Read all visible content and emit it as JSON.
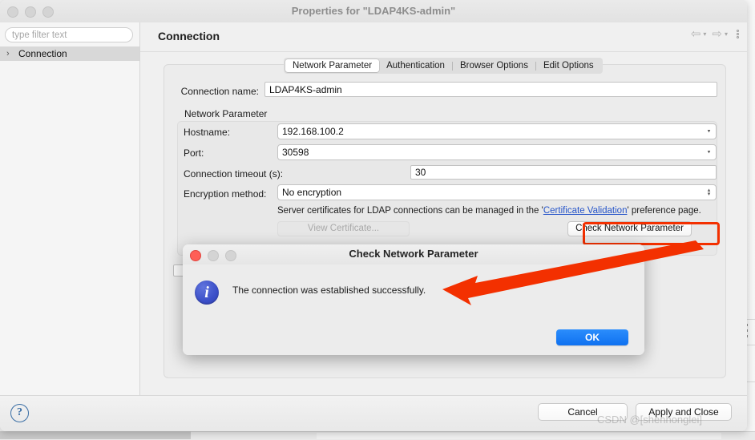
{
  "window": {
    "title": "Properties for \"LDAP4KS-admin\"",
    "traffic_lights": [
      "close",
      "minimize",
      "maximize"
    ]
  },
  "sidebar": {
    "filter_placeholder": "type filter text",
    "filter_value": "",
    "items": [
      {
        "label": "Connection",
        "expander": "›",
        "selected": true
      }
    ]
  },
  "content": {
    "title": "Connection",
    "nav": {
      "back_icon": "⇦",
      "back_caret": "▾",
      "forward_icon": "⇨",
      "forward_caret": "▾",
      "menu_icon": "kebab-menu-icon"
    }
  },
  "tabs": [
    {
      "label": "Network Parameter",
      "active": true
    },
    {
      "label": "Authentication",
      "active": false
    },
    {
      "label": "Browser Options",
      "active": false
    },
    {
      "label": "Edit Options",
      "active": false
    }
  ],
  "form": {
    "connection_name_label": "Connection name:",
    "connection_name_value": "LDAP4KS-admin",
    "group_title": "Network Parameter",
    "hostname_label": "Hostname:",
    "hostname_value": "192.168.100.2",
    "port_label": "Port:",
    "port_value": "30598",
    "timeout_label": "Connection timeout (s):",
    "timeout_value": "30",
    "encryption_label": "Encryption method:",
    "encryption_value": "No encryption",
    "cert_hint_prefix": "Server certificates for LDAP connections can be managed in the '",
    "cert_hint_link": "Certificate Validation",
    "cert_hint_suffix": "' preference page.",
    "view_certificate_button": "View Certificate...",
    "check_network_button": "Check Network Parameter"
  },
  "bottom": {
    "help_icon": "?",
    "cancel_button": "Cancel",
    "apply_button": "Apply and Close"
  },
  "dialog": {
    "title": "Check Network Parameter",
    "message": "The connection was established successfully.",
    "icon": "info-icon",
    "ok_button": "OK"
  },
  "annotations": {
    "highlight_target": "Check Network Parameter",
    "arrow_color": "#f33000",
    "highlight_color": "#f33000"
  },
  "watermark": {
    "text": "CSDN @[shenhonglei]"
  },
  "colors": {
    "accent_blue": "#1a7ff5",
    "link_blue": "#2453c9",
    "annotation_red": "#f33000",
    "window_bg": "#ececec"
  }
}
